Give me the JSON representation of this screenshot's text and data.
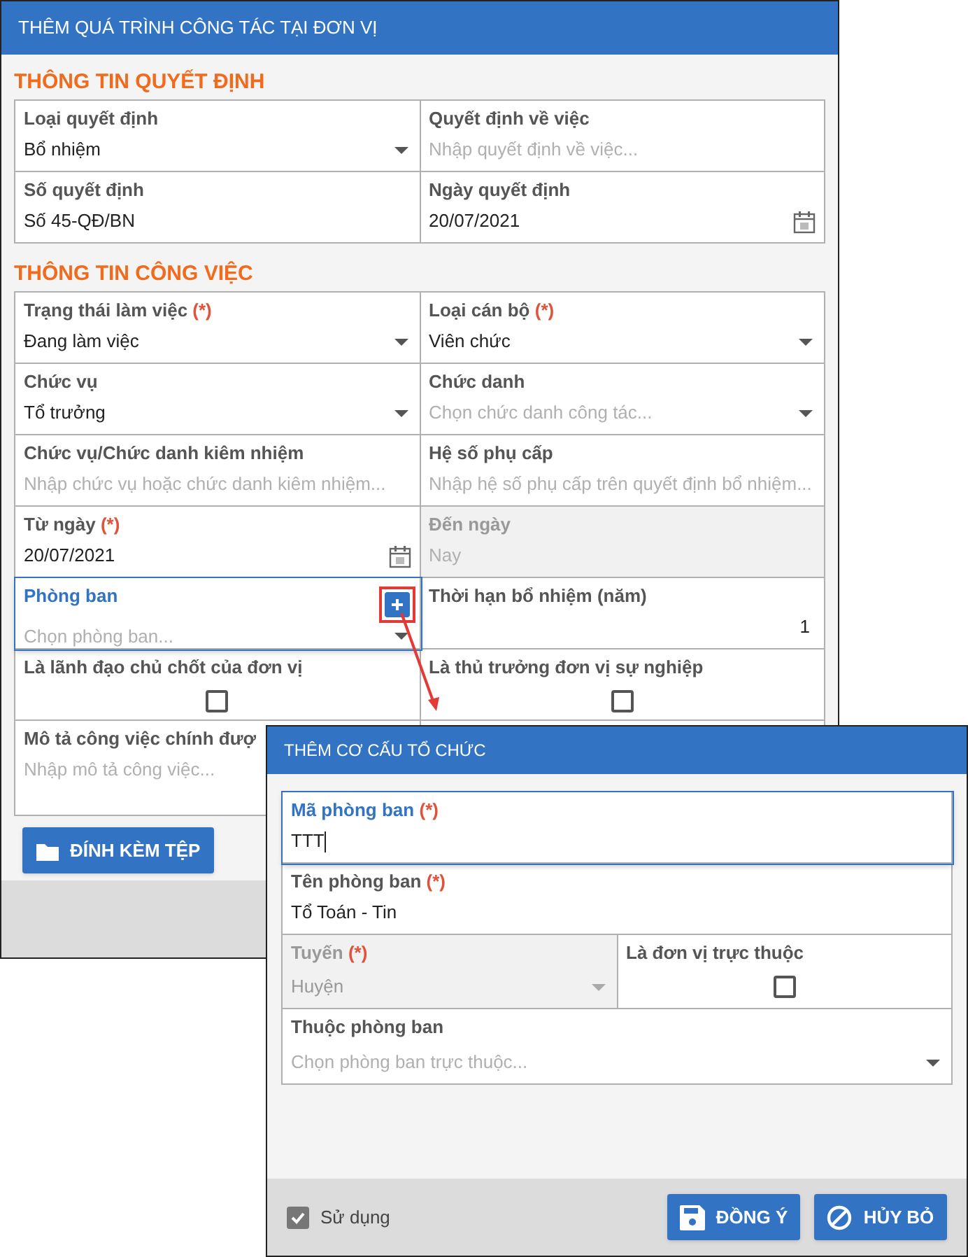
{
  "window": {
    "title": "THÊM QUÁ TRÌNH CÔNG TÁC TẠI ĐƠN VỊ"
  },
  "sections": [
    {
      "title": "THÔNG TIN QUYẾT ĐỊNH",
      "rows": [
        [
          {
            "label": "Loại quyết định",
            "kind": "select",
            "value": "Bổ nhiệm"
          },
          {
            "label": "Quyết định về việc",
            "kind": "text",
            "placeholder": "Nhập quyết định về việc..."
          }
        ],
        [
          {
            "label": "Số quyết định",
            "kind": "text",
            "value": "Số 45-QĐ/BN"
          },
          {
            "label": "Ngày quyết định",
            "kind": "date",
            "value": "20/07/2021"
          }
        ]
      ]
    },
    {
      "title": "THÔNG TIN CÔNG VIỆC",
      "rows": [
        [
          {
            "label": "Trạng thái làm việc",
            "required_mark": "(*)",
            "kind": "select",
            "value": "Đang làm việc"
          },
          {
            "label": "Loại cán bộ",
            "required_mark": "(*)",
            "kind": "select",
            "value": "Viên chức"
          }
        ],
        [
          {
            "label": "Chức vụ",
            "kind": "select",
            "value": "Tổ trưởng"
          },
          {
            "label": "Chức danh",
            "kind": "select",
            "placeholder": "Chọn chức danh công tác..."
          }
        ],
        [
          {
            "label": "Chức vụ/Chức danh kiêm nhiệm",
            "kind": "text",
            "placeholder": "Nhập chức vụ hoặc chức danh kiêm nhiệm..."
          },
          {
            "label": "Hệ số phụ cấp",
            "kind": "text",
            "placeholder": "Nhập hệ số phụ cấp trên quyết định bổ nhiệm..."
          }
        ],
        [
          {
            "label": "Từ ngày",
            "required_mark": "(*)",
            "kind": "date",
            "value": "20/07/2021"
          },
          {
            "label": "Đến ngày",
            "kind": "text",
            "placeholder": "Nay",
            "disabled": true
          }
        ],
        [
          {
            "label": "Phòng ban",
            "kind": "select",
            "placeholder": "Chọn phòng ban...",
            "focused": true,
            "add_button": true
          },
          {
            "label": "Thời hạn bổ nhiệm (năm)",
            "kind": "number",
            "value": "1"
          }
        ],
        [
          {
            "label": "Là lãnh đạo chủ chốt của đơn vị",
            "kind": "checkbox",
            "checked": false
          },
          {
            "label": "Là thủ trưởng đơn vị sự nghiệp",
            "kind": "checkbox",
            "checked": false
          }
        ],
        [
          {
            "label": "Mô tả công việc chính đượ",
            "kind": "textarea",
            "placeholder": "Nhập mô tả công việc..."
          }
        ]
      ]
    }
  ],
  "attach_button": {
    "label": "ĐÍNH KÈM TỆP"
  },
  "dialog": {
    "title": "THÊM CƠ CẤU TỔ CHỨC",
    "rows": [
      [
        {
          "label": "Mã phòng ban",
          "required_mark": "(*)",
          "kind": "text",
          "value": "TTT",
          "focused": true
        }
      ],
      [
        {
          "label": "Tên phòng ban",
          "required_mark": "(*)",
          "kind": "text",
          "value": "Tổ Toán - Tin"
        }
      ],
      [
        {
          "label": "Tuyến",
          "required_mark": "(*)",
          "kind": "select",
          "value": "Huyện",
          "disabled": true
        },
        {
          "label": "Là đơn vị trực thuộc",
          "kind": "checkbox",
          "checked": false
        }
      ],
      [
        {
          "label": "Thuộc phòng ban",
          "kind": "select",
          "placeholder": "Chọn phòng ban trực thuộc..."
        }
      ]
    ],
    "use_checkbox": {
      "label": "Sử dụng",
      "checked": true
    },
    "buttons": [
      {
        "label": "ĐỒNG Ý",
        "kind": "save"
      },
      {
        "label": "HỦY BỎ",
        "kind": "cancel"
      }
    ]
  }
}
